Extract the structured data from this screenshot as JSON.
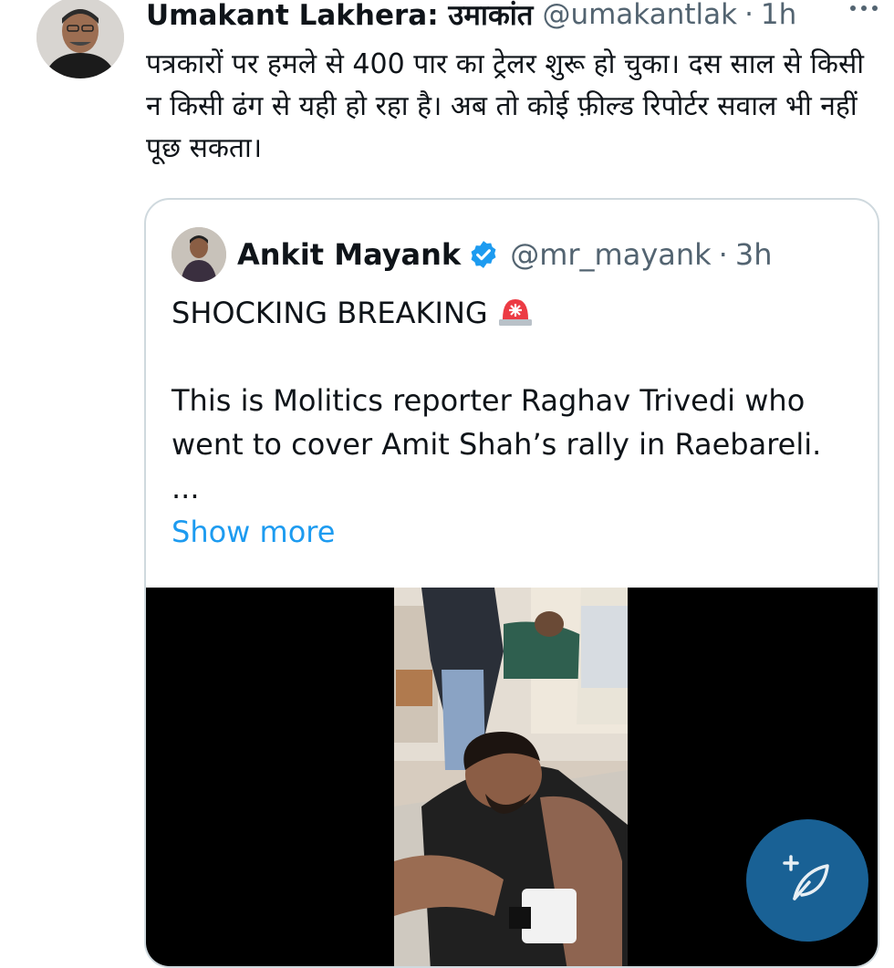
{
  "tweet": {
    "author_name": "Umakant Lakhera: उमाकांत",
    "author_handle": "@umakantlak",
    "separator": "·",
    "time": "1h",
    "text": "पत्रकारों पर हमले से 400 पार का ट्रेलर शुरू हो चुका। दस साल से किसी न किसी ढंग से यही हो रहा है। अब तो कोई फ़ील्ड रिपोर्टर सवाल भी नहीं पूछ सकता।"
  },
  "quote": {
    "author_name": "Ankit Mayank",
    "author_handle": "@mr_mayank",
    "separator": "·",
    "time": "3h",
    "headline": "SHOCKING BREAKING",
    "line1": "This is Molitics reporter Raghav Trivedi who",
    "line2": "went to cover Amit Shah’s rally in Raebareli.",
    "ellipsis": "...",
    "show_more": "Show more"
  },
  "icons": {
    "more": "more-options-icon",
    "verified": "verified-badge-icon",
    "siren": "police-light-emoji-icon",
    "compose": "compose-post-icon"
  },
  "colors": {
    "link": "#1d9bf0",
    "verified": "#1d9bf0",
    "fab": "#1d6eaa",
    "secondary_text": "#536471"
  }
}
